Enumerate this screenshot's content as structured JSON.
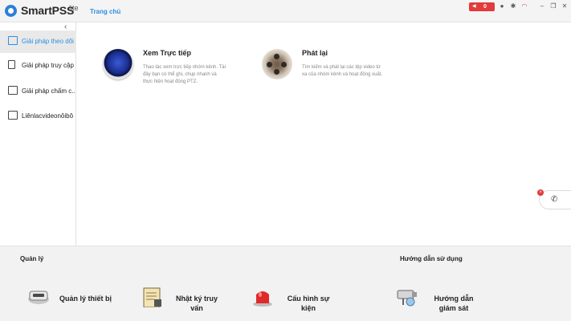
{
  "titlebar": {
    "app_name": "SmartPSS",
    "app_sup": "lite",
    "home_tab": "Trang chủ",
    "alarm_count": "0",
    "icons": [
      "speaker-icon",
      "user-icon",
      "gear-icon",
      "gauge-icon",
      "minimize-icon",
      "restore-icon",
      "close-icon"
    ]
  },
  "sidebar": {
    "collapse_glyph": "‹",
    "items": [
      {
        "label": "Giải pháp theo dõi",
        "icon": "camera-icon",
        "active": true
      },
      {
        "label": "Giải pháp truy cập",
        "icon": "door-icon",
        "active": false
      },
      {
        "label": "Giải pháp chấm c...",
        "icon": "calendar-check-icon",
        "active": false
      },
      {
        "label": "Liênlacvideonôibô",
        "icon": "intercom-icon",
        "active": false
      }
    ]
  },
  "main": {
    "live": {
      "title": "Xem Trực tiếp",
      "desc_1": "Thao tác xem trực tiếp nhóm kênh. Tài",
      "desc_2": "đây bạn có thể ghi, chụp nhanh và",
      "desc_3": "thực hiện hoạt động PTZ."
    },
    "playback": {
      "title": "Phát lại",
      "desc_1": "Tìm kiếm và phát lại các tệp video từ",
      "desc_2": "xa của nhóm kênh và hoạt động xuất."
    }
  },
  "bottom": {
    "manage_title": "Quản lý",
    "guide_title": "Hướng dẫn sử dụng",
    "tools": [
      {
        "label_1": "Quản lý thiết bị",
        "label_2": ""
      },
      {
        "label_1": "Nhật ký truy",
        "label_2": "vấn"
      },
      {
        "label_1": "Cấu hình sự",
        "label_2": "kiện"
      },
      {
        "label_1": "Hướng dẫn",
        "label_2": "giám sát"
      }
    ]
  },
  "colors": {
    "accent": "#2b8fe0",
    "alarm": "#e23b3b"
  }
}
